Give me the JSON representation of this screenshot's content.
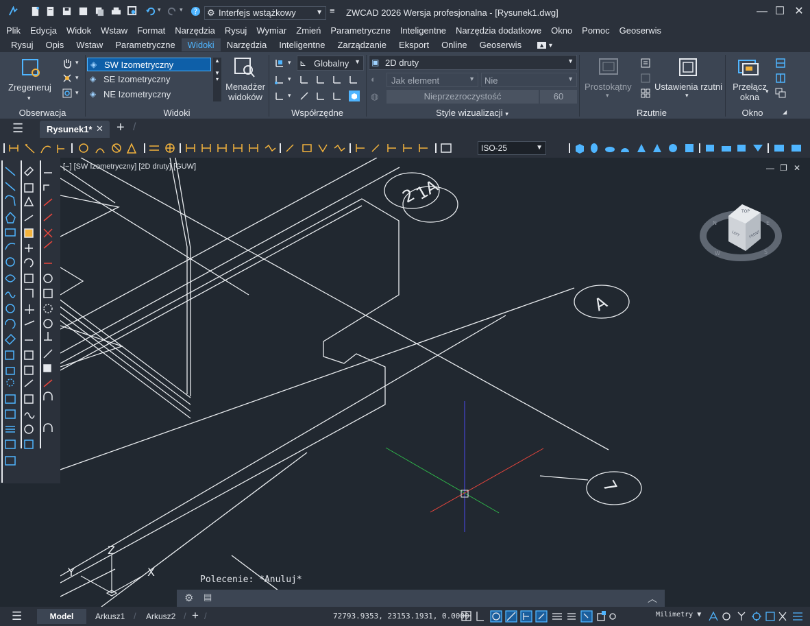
{
  "title": {
    "workspace": "Interfejs wstążkowy",
    "app_title": "ZWCAD 2026 Wersja profesjonalna - [Rysunek1.dwg]"
  },
  "menu": [
    "Plik",
    "Edycja",
    "Widok",
    "Wstaw",
    "Format",
    "Narzędzia",
    "Rysuj",
    "Wymiar",
    "Zmień",
    "Parametryczne",
    "Inteligentne",
    "Narzędzia dodatkowe",
    "Okno",
    "Pomoc",
    "Geoserwis"
  ],
  "ribbon_tabs": [
    "Rysuj",
    "Opis",
    "Wstaw",
    "Parametryczne",
    "Widoki",
    "Narzędzia",
    "Inteligentne",
    "Zarządzanie",
    "Eksport",
    "Online",
    "Geoserwis"
  ],
  "ribbon_active_tab": "Widoki",
  "ribbon": {
    "regen_label": "Zregeneruj",
    "observation_label": "Obserwacja",
    "views": [
      "SW Izometryczny",
      "SE Izometryczny",
      "NE Izometryczny"
    ],
    "views_label": "Widoki",
    "view_manager_line1": "Menadżer",
    "view_manager_line2": "widoków",
    "ucs_value": "Globalny",
    "coords_label": "Współrzędne",
    "visual_style": "2D druty",
    "as_element": "Jak element",
    "no_value": "Nie",
    "opacity_label": "Nieprzezroczystość",
    "opacity_value": "60",
    "styles_label": "Style wizualizacji",
    "rect_label": "Prostokątny",
    "viewport_settings": "Ustawienia rzutni",
    "viewports_label": "Rzutnie",
    "switch_window_line1": "Przełącz",
    "switch_window_line2": "okna",
    "window_label": "Okno"
  },
  "doc_tab": "Rysunek1*",
  "dim_style": "ISO-25",
  "viewport_label": "[−] [SW Izometryczny] [2D druty] [GUW]",
  "canvas": {
    "grid_labels": [
      "2",
      "1A",
      "A",
      "7"
    ],
    "ucs_axes": [
      "Z",
      "Y",
      "X"
    ],
    "viewcube": {
      "top": "TOP",
      "left": "LEFT",
      "front": "FRONT",
      "n": "N",
      "e": "E",
      "w": "W",
      "s": "S"
    }
  },
  "command": "Polecenie: *Anuluj*",
  "status": {
    "tabs": [
      "Model",
      "Arkusz1",
      "Arkusz2"
    ],
    "coords": "72793.9353, 23153.1931, 0.0000",
    "units": "Milimetry"
  },
  "colors": {
    "accent": "#4fb5ff",
    "panel": "#3c4553",
    "bar": "#2b313b",
    "canvas": "#212830"
  }
}
